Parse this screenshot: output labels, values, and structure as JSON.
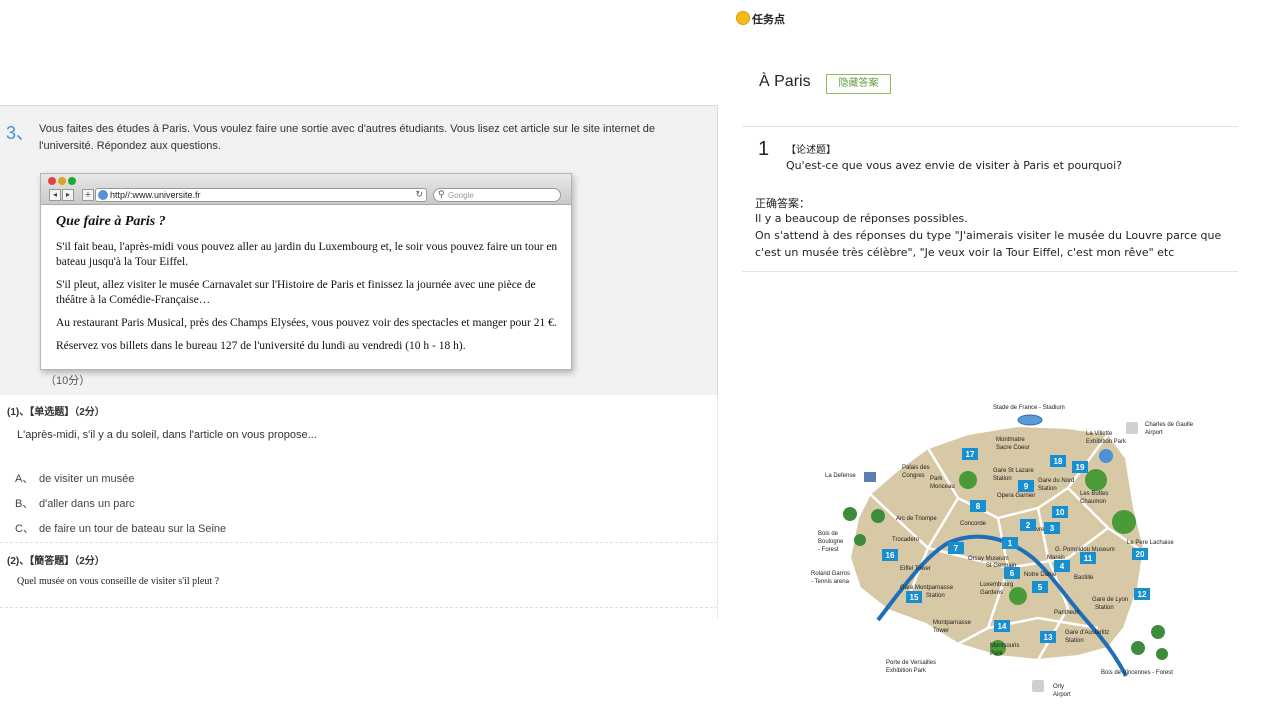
{
  "question": {
    "number": "3、",
    "text": "Vous faites des études à Paris. Vous voulez faire une sortie avec d'autres étudiants. Vous lisez cet article sur le site internet de l'université. Répondez aux questions.",
    "points": "（10分）",
    "browser": {
      "url": "http//:www.universite.fr",
      "search_placeholder": "Google",
      "article_title": "Que faire à Paris ?",
      "paragraphs": [
        "S'il fait beau, l'après-midi vous pouvez aller au jardin du Luxembourg et, le soir vous pouvez faire un tour en bateau jusqu'à la Tour Eiffel.",
        "S'il pleut, allez visiter le musée Carnavalet sur l'Histoire de Paris et finissez la journée avec une pièce de théâtre à la Comédie-Française…",
        "Au restaurant Paris Musical, près des Champs Elysées, vous pouvez voir des spectacles et manger pour 21 €.",
        "Réservez vos billets dans le bureau 127 de l'université du lundi au vendredi (10 h - 18 h)."
      ]
    }
  },
  "sub_questions": [
    {
      "title": "(1)、【单选题】（2分）",
      "text": "L'après-midi, s'il y a du soleil, dans l'article on vous propose...",
      "options": [
        {
          "letter": "A、",
          "text": "de visiter un musée"
        },
        {
          "letter": "B、",
          "text": "d'aller dans un parc"
        },
        {
          "letter": "C、",
          "text": "de faire un tour de bateau sur la Seine"
        }
      ]
    },
    {
      "title": "(2)、【簡答題】（2分）",
      "text": "Quel musée on vous conseille de visiter s'il pleut ?"
    }
  ],
  "right": {
    "task_label": "任务点",
    "title": "À Paris",
    "hide_answer": "隐藏答案",
    "answer": {
      "number": "1",
      "type": "【论述题】",
      "question": "Qu'est-ce que vous avez envie de visiter à Paris et pourquoi?",
      "correct_label": "正确答案：",
      "line1": "Il y a beaucoup de réponses possibles.",
      "line2": "On s'attend à des réponses du type \"J'aimerais visiter le musée du Louvre parce que c'est un musée très célèbre\", \"Je veux voir la Tour Eiffel, c'est mon rêve\" etc"
    }
  },
  "map": {
    "labels": {
      "stade": "Stade de France - Stadium",
      "cdg1": "Charles de Gaulle",
      "cdg2": "Airport",
      "villette1": "La Villette",
      "villette2": "Exhibition Park",
      "montmartre1": "Montmatre",
      "montmartre2": "Sacre Coeur",
      "defense": "La Defense",
      "palais1": "Palais des",
      "palais2": "Congres",
      "monceau1": "Park",
      "monceau2": "Monceau",
      "stlazare1": "Gare St Lazare",
      "stlazare2": "Station",
      "garenord1": "Gare du Nord",
      "garenord2": "Station",
      "buttes1": "Les Buttes",
      "buttes2": "Chaumon",
      "opera": "Opera Garnier",
      "arc": "Arc de Triompe",
      "concorde": "Concorde",
      "louvre": "Louvre",
      "boulogne1": "Bois de",
      "boulogne2": "Boulogne",
      "boulogne3": "- Forest",
      "trocadero": "Trocadero",
      "orsay1": "Orsay Museum",
      "orsay2": "St Germain",
      "pompidou1": "G. Pompidou Museum",
      "pompidou2": "Marais",
      "perelachaise": "Le Pere Lachaise",
      "eiffel": "Eiffel Tower",
      "notredame": "Notre Dame",
      "bastille": "Bastille",
      "garros1": "Roland Garros",
      "garros2": "- Tennis arena",
      "montparnasse1": "Gare Montparnasse",
      "montparnasse2": "Station",
      "luxembourg1": "Luxembourg",
      "luxembourg2": "Gardens",
      "pantheon": "Pantheon",
      "lyon1": "Gare de Lyon",
      "lyon2": "Station",
      "mtower1": "Montparnasse",
      "mtower2": "Tower",
      "montsouris1": "Montsouris",
      "montsouris2": "Park",
      "austerlitz1": "Gare d'Austerlitz",
      "austerlitz2": "Station",
      "versailles1": "Porte de Versailles",
      "versailles2": "Exhibition Park",
      "vincennes": "Bois de Vincennes - Forest",
      "orly1": "Orly",
      "orly2": "Airport"
    },
    "numbers": [
      "1",
      "2",
      "3",
      "4",
      "5",
      "6",
      "7",
      "8",
      "9",
      "10",
      "11",
      "12",
      "13",
      "14",
      "15",
      "16",
      "17",
      "18",
      "19",
      "20"
    ]
  }
}
